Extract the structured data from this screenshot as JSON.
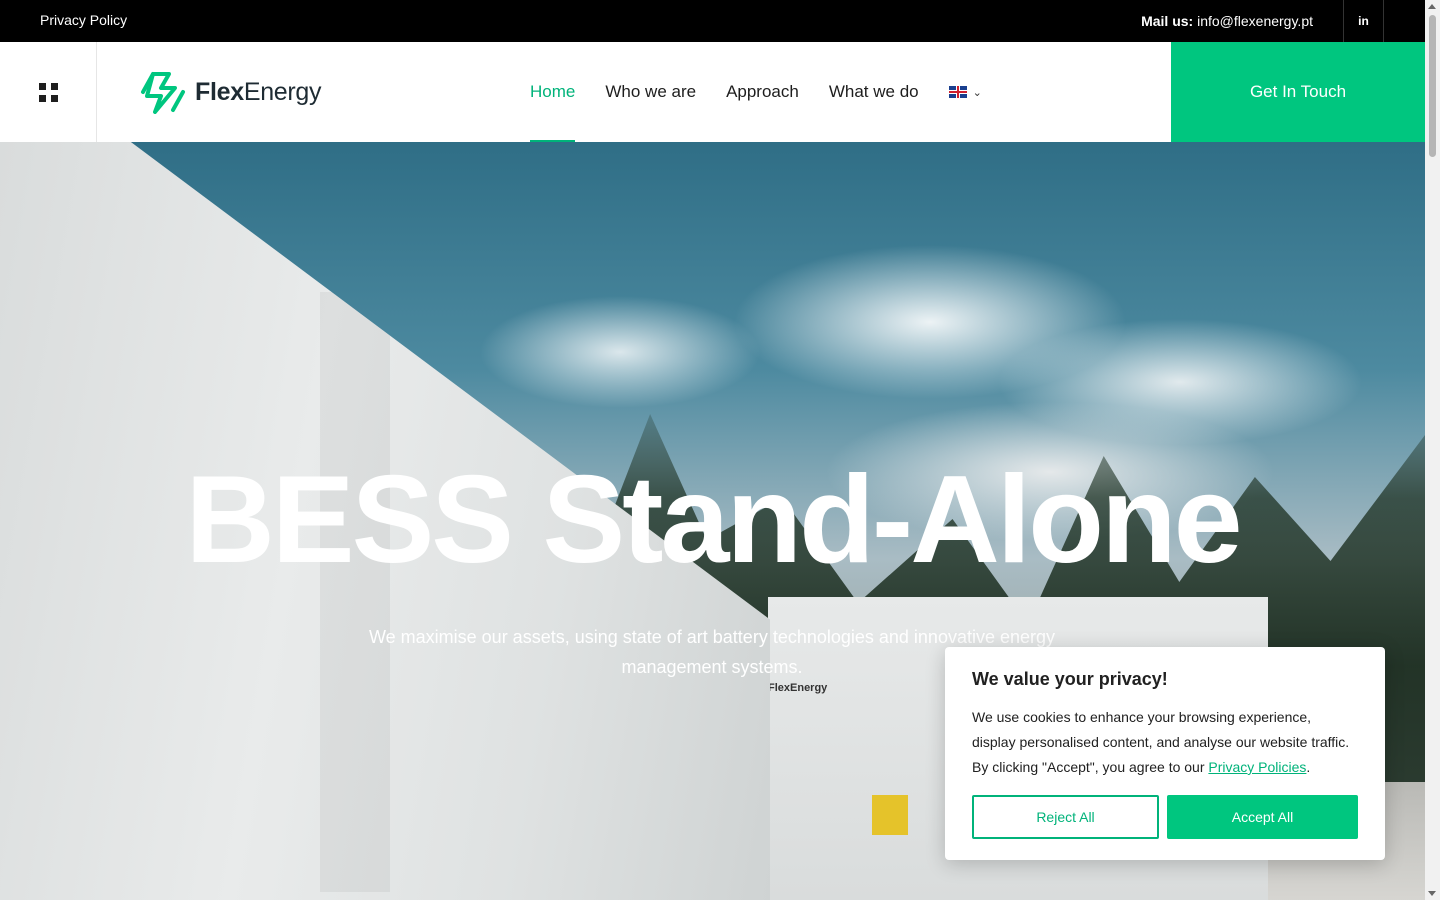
{
  "topbar": {
    "privacy_label": "Privacy Policy",
    "mail_label": "Mail us:",
    "mail_value": "info@flexenergy.pt",
    "social_label": "in"
  },
  "header": {
    "logo_flex": "Flex",
    "logo_energy": "Energy",
    "nav": [
      {
        "label": "Home",
        "active": true
      },
      {
        "label": "Who we are"
      },
      {
        "label": "Approach"
      },
      {
        "label": "What we do"
      }
    ],
    "language_icon": "uk-flag-icon",
    "cta_label": "Get In Touch"
  },
  "hero": {
    "title": "BESS Stand-Alone",
    "subtitle": "We maximise our assets, using state of art battery technologies and innovative energy management systems.",
    "container_logo": "FlexEnergy"
  },
  "cookie": {
    "title": "We value your privacy!",
    "text": "We use cookies to enhance your browsing experience, display personalised content, and analyse our website traffic. By clicking \"Accept\", you agree to our ",
    "link_label": "Privacy Policies",
    "text_end": ".",
    "reject_label": "Reject All",
    "accept_label": "Accept All"
  },
  "colors": {
    "accent": "#00c67f",
    "accent_text": "#00b37a",
    "topbar": "#000000"
  }
}
